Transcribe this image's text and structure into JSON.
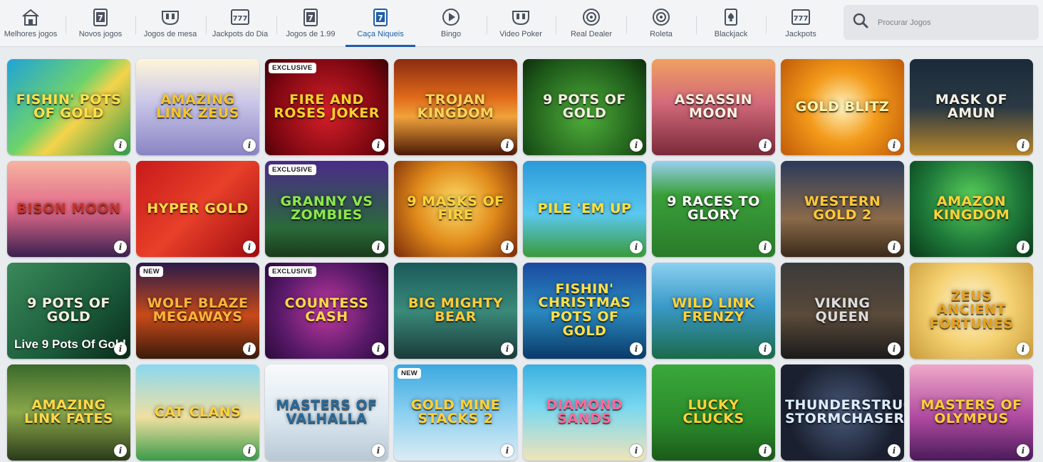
{
  "nav": {
    "items": [
      {
        "label": "Melhores jogos",
        "icon": "house-icon"
      },
      {
        "label": "Novos jogos",
        "icon": "slot-7-icon"
      },
      {
        "label": "Jogos de mesa",
        "icon": "table-games-icon"
      },
      {
        "label": "Jackpots do Dia",
        "icon": "triple-seven-icon"
      },
      {
        "label": "Jogos de 1.99",
        "icon": "slot-7-icon"
      },
      {
        "label": "Caça Niqueis",
        "icon": "slot-7-icon"
      },
      {
        "label": "Bingo",
        "icon": "play-circle-icon"
      },
      {
        "label": "Video Poker",
        "icon": "video-poker-icon"
      },
      {
        "label": "Real Dealer",
        "icon": "roulette-icon"
      },
      {
        "label": "Roleta",
        "icon": "roulette-icon"
      },
      {
        "label": "Blackjack",
        "icon": "spade-card-icon"
      },
      {
        "label": "Jackpots",
        "icon": "triple-seven-icon"
      }
    ],
    "active_index": 5,
    "active_color": "#1f5ea8"
  },
  "search": {
    "placeholder": "Procurar Jogos",
    "icon": "search-icon"
  },
  "games": [
    {
      "title": "Fishin' Pots of Gold",
      "badge": "",
      "bg": "linear-gradient(135deg,#1fa3d8,#6fd36a 45%,#f4d34a 60%,#2e9b4a)",
      "tc": "#ffe04a"
    },
    {
      "title": "Amazing Link Zeus",
      "badge": "",
      "bg": "linear-gradient(180deg,#fff6d8,#c9c6e8 45%,#8a84c4)",
      "tc": "#f4c430"
    },
    {
      "title": "Fire and Roses Joker",
      "badge": "EXCLUSIVE",
      "bg": "radial-gradient(circle at 50% 55%,#d8202a,#7a0610 70%,#3a0206)",
      "tc": "#ffcf2e"
    },
    {
      "title": "Trojan Kingdom",
      "badge": "",
      "bg": "linear-gradient(180deg,#8a2a10,#e06a1a 40%,#f0a23a 60%,#4a1806)",
      "tc": "#ffd35a"
    },
    {
      "title": "9 Pots of Gold",
      "badge": "",
      "bg": "radial-gradient(circle at 50% 60%,#4fae3a,#1e5a1a 70%,#0e2e0c)",
      "tc": "#f3efe0"
    },
    {
      "title": "Assassin Moon",
      "badge": "",
      "bg": "linear-gradient(180deg,#f0a060,#d46a7a 45%,#7a2a3a)",
      "tc": "#fff0e0"
    },
    {
      "title": "Gold Blitz",
      "badge": "",
      "bg": "radial-gradient(circle at 50% 50%,#fff4c0,#f39a1a 45%,#c05a08)",
      "tc": "#fff4b0"
    },
    {
      "title": "Mask of Amun",
      "badge": "",
      "bg": "linear-gradient(180deg,#1a2a3a,#2b3a44 50%,#b8862a)",
      "tc": "#f4f0e4"
    },
    {
      "title": "Bison Moon",
      "badge": "",
      "bg": "linear-gradient(180deg,#f6b4a0,#e26a8a 50%,#3a2050)",
      "tc": "#c8322a"
    },
    {
      "title": "Hyper Gold",
      "badge": "",
      "bg": "linear-gradient(135deg,#c81a1a,#e8402a 50%,#a00a10)",
      "tc": "#ffd84a"
    },
    {
      "title": "Granny vs Zombies",
      "badge": "EXCLUSIVE",
      "bg": "linear-gradient(180deg,#4a2a8a,#2a6a3a 70%,#1a3a1a)",
      "tc": "#8be84a"
    },
    {
      "title": "9 Masks of Fire",
      "badge": "",
      "bg": "radial-gradient(circle at 50% 45%,#ffe06a,#e08a1a 50%,#7a2a0a)",
      "tc": "#ffd23a"
    },
    {
      "title": "Pile 'Em Up",
      "badge": "",
      "bg": "linear-gradient(180deg,#2a9ad8,#5ac8f0 55%,#3a9a3a)",
      "tc": "#ffe23a"
    },
    {
      "title": "9 Races to Glory",
      "badge": "",
      "bg": "linear-gradient(180deg,#9ad0f0,#3aa03a 35%,#2a7a2a)",
      "tc": "#ffffff"
    },
    {
      "title": "Western Gold 2",
      "badge": "",
      "bg": "linear-gradient(180deg,#2a3a5a,#8a6a4a 60%,#3a2a1a)",
      "tc": "#ffc83a"
    },
    {
      "title": "Amazon Kingdom",
      "badge": "",
      "bg": "radial-gradient(circle at 50% 40%,#5ad05a,#1e7a3a 55%,#0a3a1a)",
      "tc": "#ffd23a"
    },
    {
      "title": "9 Pots of Gold",
      "badge": "",
      "bg": "linear-gradient(135deg,#3a8a5a,#1a5a3a 60%,#0a2a1a)",
      "tc": "#f4f0e0",
      "sub": "Live 9 Pots Of Gold"
    },
    {
      "title": "Wolf Blaze Megaways",
      "badge": "NEW",
      "bg": "linear-gradient(180deg,#2a1a4a,#c84a1a 55%,#3a1a0a)",
      "tc": "#ffb43a"
    },
    {
      "title": "Countess Cash",
      "badge": "EXCLUSIVE",
      "bg": "radial-gradient(circle at 50% 50%,#c03aa0,#5a1a6a 60%,#2a0a3a)",
      "tc": "#ffd84a"
    },
    {
      "title": "Big Mighty Bear",
      "badge": "",
      "bg": "linear-gradient(180deg,#1a5a5a,#3a8a7a 50%,#1a3a3a)",
      "tc": "#ffcc3a"
    },
    {
      "title": "Fishin' Christmas Pots of Gold",
      "badge": "",
      "bg": "linear-gradient(180deg,#1a4aa0,#2a8ac0 50%,#0a3a6a)",
      "tc": "#ffe04a"
    },
    {
      "title": "Wild Link Frenzy",
      "badge": "",
      "bg": "linear-gradient(180deg,#8ad0f0,#3a9ac8 45%,#1a6a4a)",
      "tc": "#ffd23a"
    },
    {
      "title": "Viking Queen",
      "badge": "",
      "bg": "linear-gradient(180deg,#3a3a3a,#5a4a3a 55%,#1a1a1a)",
      "tc": "#dcdcdc"
    },
    {
      "title": "Zeus Ancient Fortunes",
      "badge": "",
      "bg": "radial-gradient(circle at 50% 45%,#fff8d8,#f4d070 50%,#c89a3a)",
      "tc": "#e8a01a"
    },
    {
      "title": "Amazing Link Fates",
      "badge": "",
      "bg": "linear-gradient(180deg,#3a6a2a,#8aa84a 50%,#2a3a1a)",
      "tc": "#ffd84a"
    },
    {
      "title": "Cat Clans",
      "badge": "",
      "bg": "linear-gradient(180deg,#8ad8f0,#f0e0a0 55%,#3a9a4a)",
      "tc": "#ffd23a"
    },
    {
      "title": "Masters of Valhalla",
      "badge": "",
      "bg": "linear-gradient(180deg,#f8fafc,#dce8f0 55%,#b8c8d4)",
      "tc": "#2a6a9a"
    },
    {
      "title": "Gold Mine Stacks 2",
      "badge": "NEW",
      "bg": "linear-gradient(180deg,#3aa8e0,#8ad0f0 50%,#dcecf4)",
      "tc": "#ffd23a"
    },
    {
      "title": "Diamond Sands",
      "badge": "",
      "bg": "linear-gradient(180deg,#3ab0e0,#7ad8f0 45%,#f0e4b8)",
      "tc": "#ff6a9a"
    },
    {
      "title": "Lucky Clucks",
      "badge": "",
      "bg": "linear-gradient(180deg,#3aa83a,#2a8a2a 60%,#1a5a1a)",
      "tc": "#ffd23a"
    },
    {
      "title": "Thunderstruck Stormchaser",
      "badge": "",
      "bg": "radial-gradient(circle at 50% 50%,#4a5a7a,#1a2030 70%)",
      "tc": "#dcecff"
    },
    {
      "title": "Masters of Olympus",
      "badge": "",
      "bg": "linear-gradient(180deg,#f0a8c8,#b04aa0 55%,#4a1a5a)",
      "tc": "#ffcc3a"
    }
  ],
  "info_label": "i"
}
